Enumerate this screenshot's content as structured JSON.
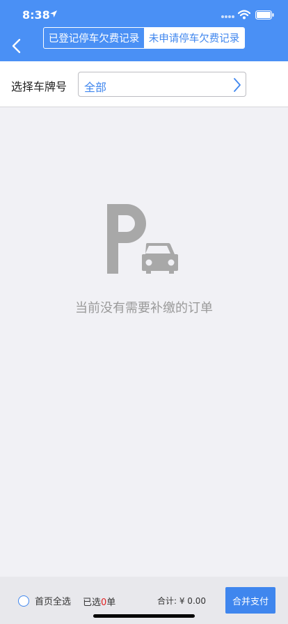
{
  "status_bar": {
    "time": "8:38"
  },
  "nav": {
    "tabs": [
      {
        "label": "已登记停车欠费记录",
        "active": false
      },
      {
        "label": "未申请停车欠费记录",
        "active": true
      }
    ]
  },
  "filter": {
    "label": "选择车牌号",
    "selected_value": "全部"
  },
  "empty_state": {
    "message": "当前没有需要补缴的订单"
  },
  "footer": {
    "select_all_label": "首页全选",
    "selected_prefix": "已选",
    "selected_count": "0",
    "selected_suffix": "单",
    "total_label": "合计: ¥ 0.00",
    "pay_button_label": "合并支付"
  },
  "colors": {
    "header_bg": "#4a90f5",
    "accent": "#3f86ee",
    "count_highlight": "#e02020",
    "empty_icon": "#a8a8a8",
    "page_bg": "#f1f1f5"
  }
}
